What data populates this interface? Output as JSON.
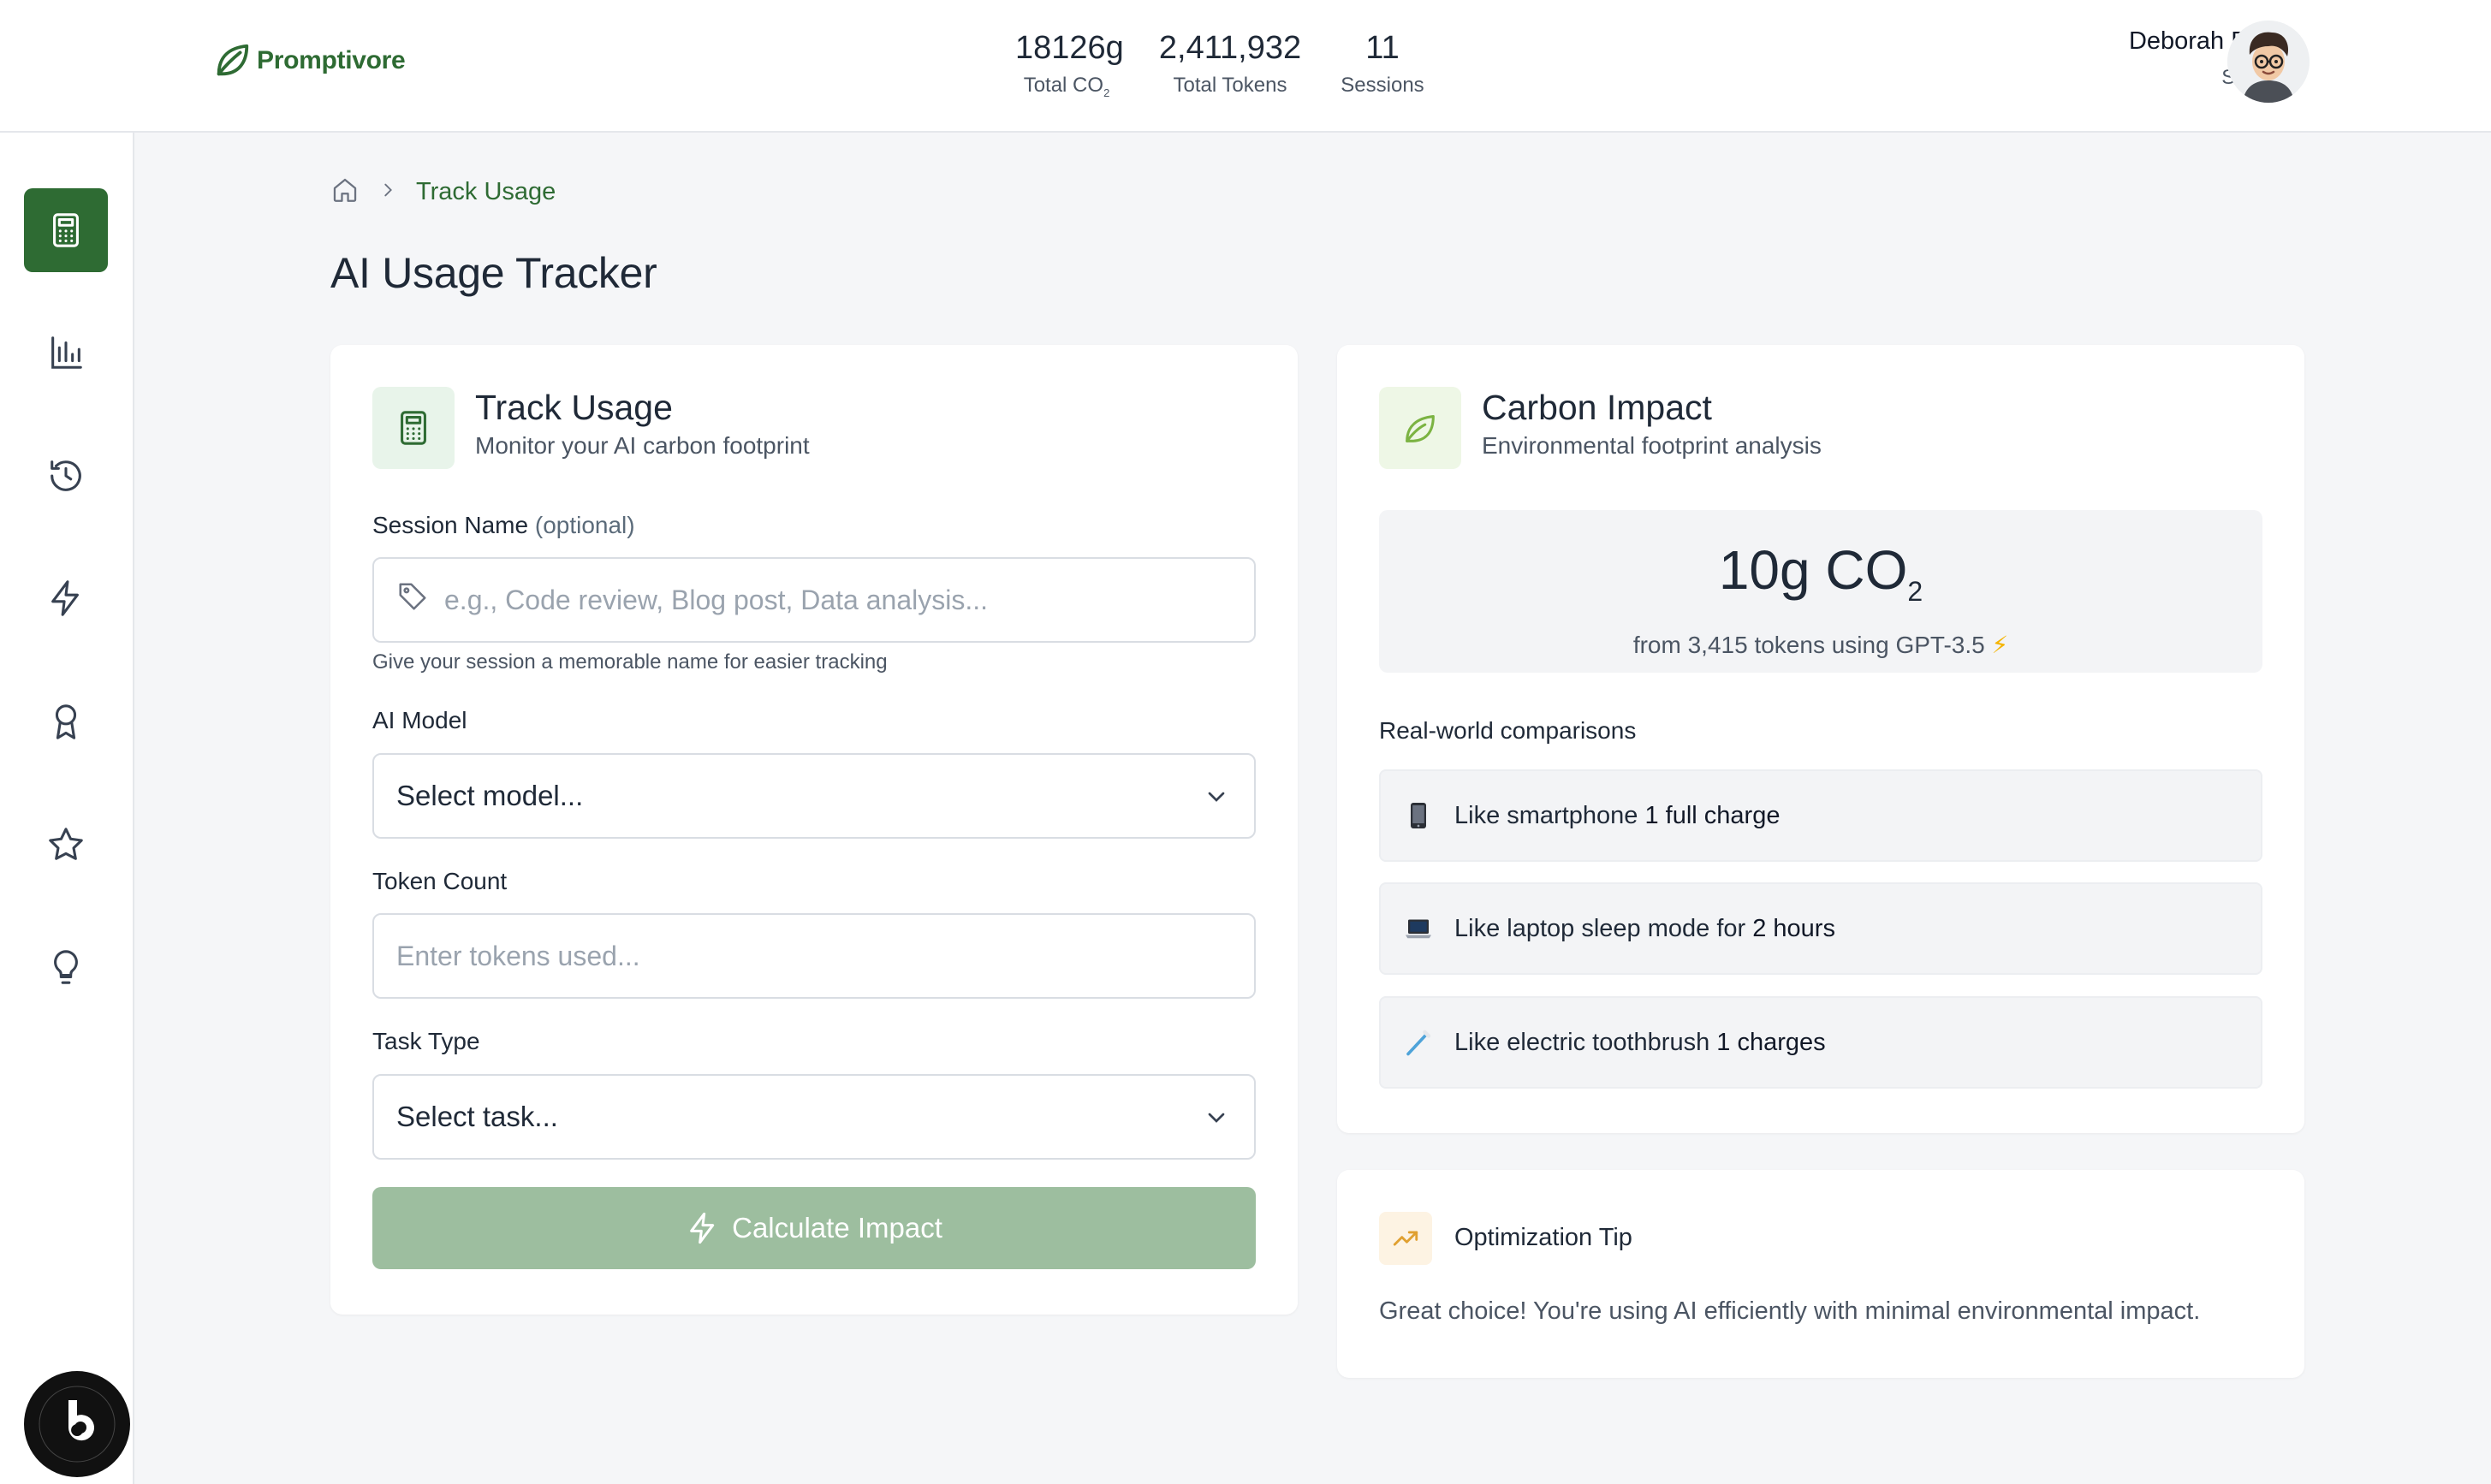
{
  "brand": {
    "name": "Promptivore",
    "accent": "#2e6b33"
  },
  "header_stats": [
    {
      "value": "18126g",
      "label": "Total CO",
      "label_sub": "2"
    },
    {
      "value": "2,411,932",
      "label": "Total Tokens",
      "label_sub": ""
    },
    {
      "value": "11",
      "label": "Sessions",
      "label_sub": ""
    }
  ],
  "user": {
    "name": "Deborah Butler",
    "settings_label": "Settings"
  },
  "sidebar": {
    "items": [
      {
        "icon": "calculator-icon",
        "active": true
      },
      {
        "icon": "bar-chart-icon",
        "active": false
      },
      {
        "icon": "history-icon",
        "active": false
      },
      {
        "icon": "lightning-icon",
        "active": false
      },
      {
        "icon": "award-icon",
        "active": false
      },
      {
        "icon": "star-icon",
        "active": false
      },
      {
        "icon": "lightbulb-icon",
        "active": false
      }
    ]
  },
  "breadcrumb": {
    "current": "Track Usage"
  },
  "page_title": "AI Usage Tracker",
  "track_card": {
    "title": "Track Usage",
    "subtitle": "Monitor your AI carbon footprint",
    "session_label": "Session Name",
    "session_optional": "(optional)",
    "session_placeholder": "e.g., Code review, Blog post, Data analysis...",
    "session_hint": "Give your session a memorable name for easier tracking",
    "model_label": "AI Model",
    "model_value": "Select model...",
    "token_label": "Token Count",
    "token_placeholder": "Enter tokens used...",
    "task_label": "Task Type",
    "task_value": "Select task...",
    "calculate_label": "Calculate Impact"
  },
  "impact_card": {
    "title": "Carbon Impact",
    "subtitle": "Environmental footprint analysis",
    "big_value": "10g CO",
    "big_sub": "2",
    "from_text": "from 3,415 tokens using GPT-3.5",
    "from_icon": "⚡",
    "comparisons_title": "Real-world comparisons",
    "comparisons": [
      {
        "icon": "smartphone-icon",
        "prefix": "Like smartphone ",
        "bold": "1 full charge"
      },
      {
        "icon": "laptop-icon",
        "prefix": "Like laptop sleep mode for ",
        "bold": "2 hours"
      },
      {
        "icon": "toothbrush-icon",
        "prefix": "Like electric toothbrush ",
        "bold": "1 charges"
      }
    ]
  },
  "tip_card": {
    "title": "Optimization Tip",
    "text": "Great choice! You're using AI efficiently with minimal environmental impact."
  }
}
